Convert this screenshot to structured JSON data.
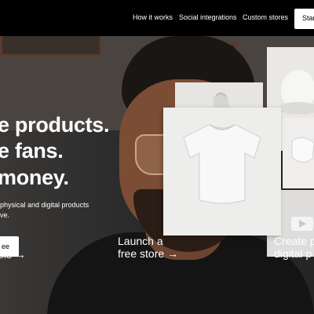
{
  "nav": {
    "items": [
      "How it works",
      "Social integrations",
      "Custom stores"
    ],
    "cta": "Star"
  },
  "hero": {
    "headline": [
      "e products.",
      "e fans.",
      "money."
    ],
    "subtext": [
      "physical and digital products",
      "ve."
    ],
    "button": "ee"
  },
  "links": {
    "left": "els →",
    "mid": [
      "Launch a",
      "free store →"
    ],
    "right": [
      "Create p",
      "digital p"
    ]
  },
  "icons": {
    "tshirt": "tshirt-icon",
    "cap": "cap-icon",
    "mask": "mask-icon",
    "play": "play-icon",
    "bag": "bag-icon"
  }
}
